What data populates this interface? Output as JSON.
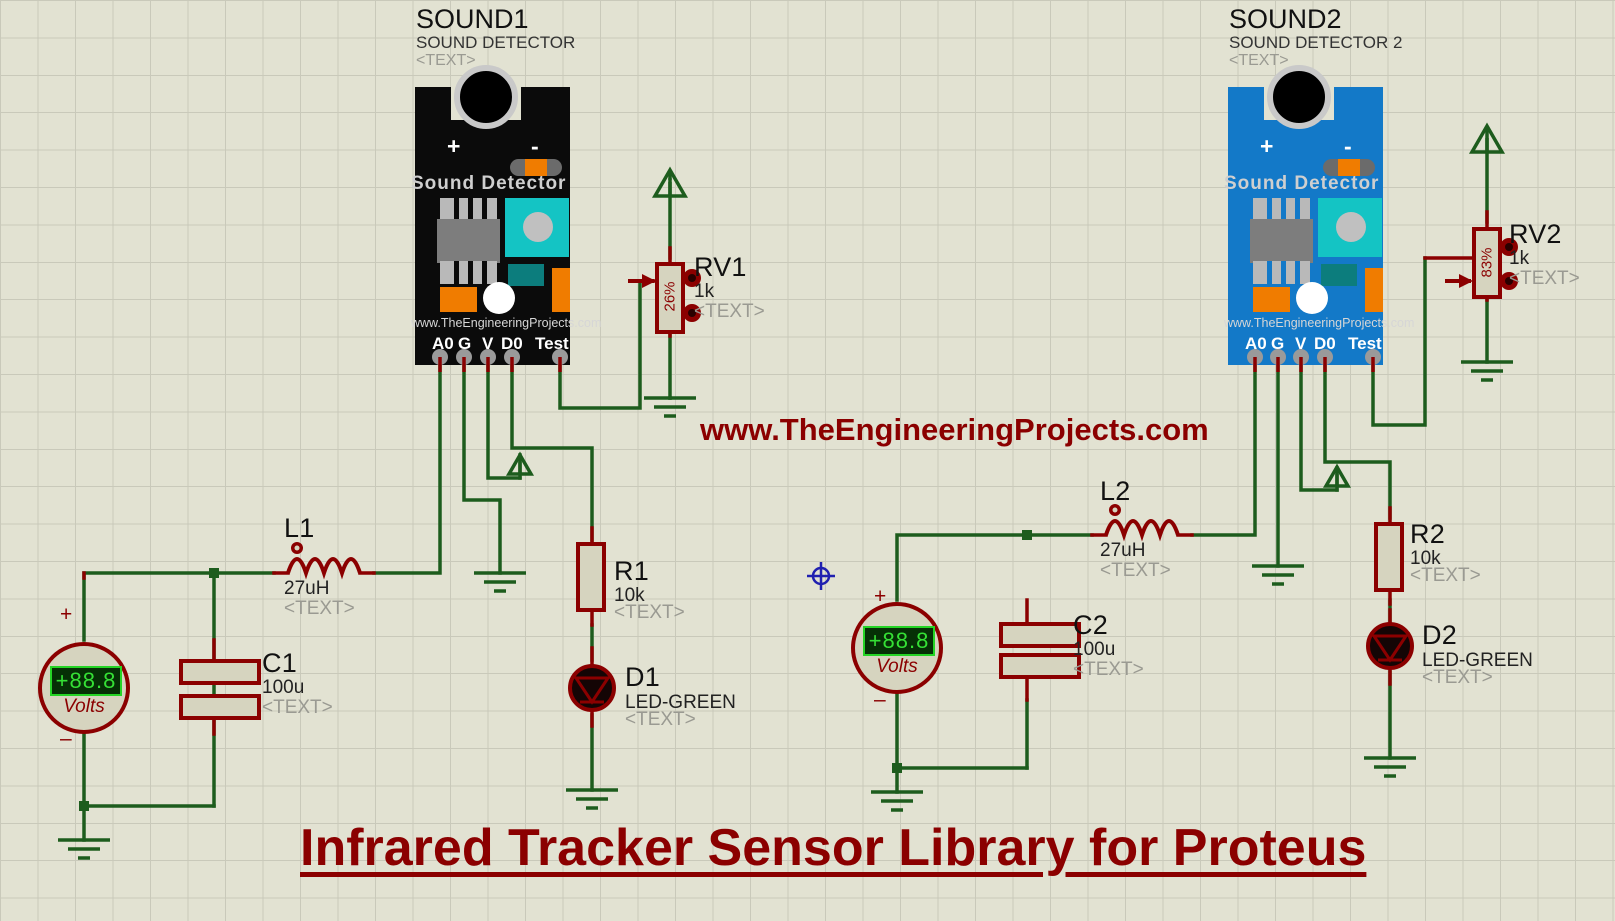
{
  "app": {
    "kind": "proteus-schematic",
    "background": "#e2e2d2",
    "grid_color": "#c9c9ba",
    "wire_color": "#1d5c1d",
    "component_color": "#8b0000",
    "title": "Infrared Tracker Sensor Library for Proteus",
    "watermark": "www.TheEngineeringProjects.com"
  },
  "modules": [
    {
      "id": "sound1",
      "ref": "SOUND1",
      "device": "SOUND DETECTOR",
      "text_field": "<TEXT>",
      "board_color": "#0b0b0b",
      "silk_name": "Sound Detector",
      "plus": "+",
      "minus": "-",
      "url": "www.TheEngineeringProjects.com",
      "pins": [
        "A0",
        "G",
        "V",
        "D0",
        "Test"
      ]
    },
    {
      "id": "sound2",
      "ref": "SOUND2",
      "device": "SOUND DETECTOR 2",
      "text_field": "<TEXT>",
      "board_color": "#1379c8",
      "silk_name": "Sound Detector",
      "plus": "+",
      "minus": "-",
      "url": "www.TheEngineeringProjects.com",
      "pins": [
        "A0",
        "G",
        "V",
        "D0",
        "Test"
      ]
    }
  ],
  "components": {
    "rv1": {
      "ref": "RV1",
      "value": "1k",
      "text_field": "<TEXT>",
      "percent": "26%"
    },
    "rv2": {
      "ref": "RV2",
      "value": "1k",
      "text_field": "<TEXT>",
      "percent": "83%"
    },
    "l1": {
      "ref": "L1",
      "value": "27uH",
      "text_field": "<TEXT>"
    },
    "l2": {
      "ref": "L2",
      "value": "27uH",
      "text_field": "<TEXT>"
    },
    "c1": {
      "ref": "C1",
      "value": "100u",
      "text_field": "<TEXT>"
    },
    "c2": {
      "ref": "C2",
      "value": "100u",
      "text_field": "<TEXT>"
    },
    "r1": {
      "ref": "R1",
      "value": "10k",
      "text_field": "<TEXT>"
    },
    "r2": {
      "ref": "R2",
      "value": "10k",
      "text_field": "<TEXT>"
    },
    "d1": {
      "ref": "D1",
      "value": "LED-GREEN",
      "text_field": "<TEXT>"
    },
    "d2": {
      "ref": "D2",
      "value": "LED-GREEN",
      "text_field": "<TEXT>"
    }
  },
  "meters": [
    {
      "id": "voltmeter-1",
      "reading": "+88.8",
      "unit": "Volts",
      "plus": "+",
      "minus": "–"
    },
    {
      "id": "voltmeter-2",
      "reading": "+88.8",
      "unit": "Volts",
      "plus": "+",
      "minus": "–"
    }
  ]
}
